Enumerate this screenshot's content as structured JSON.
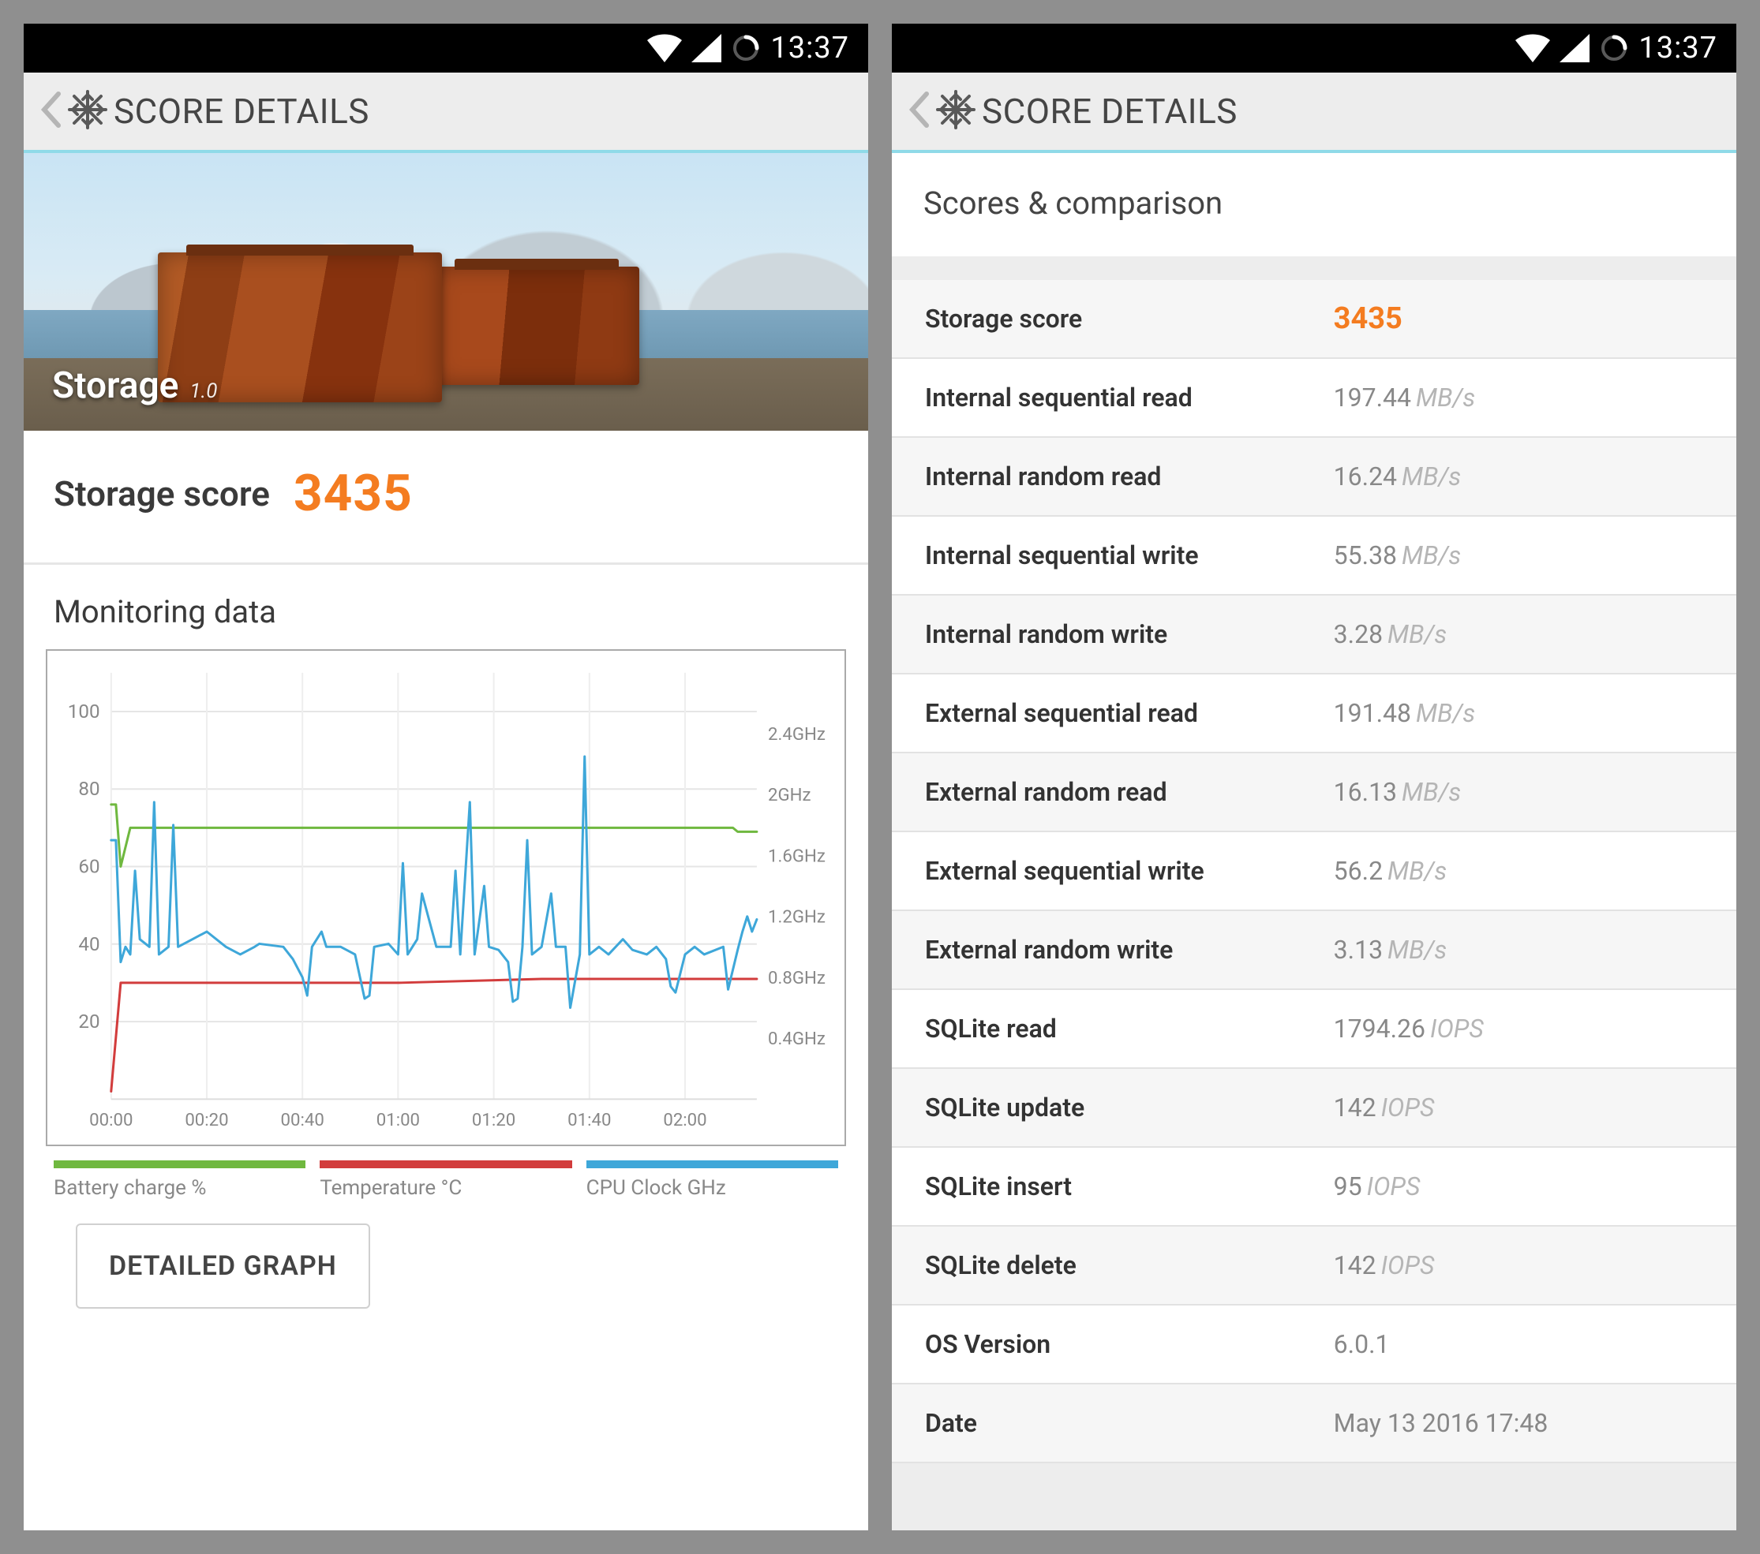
{
  "status": {
    "time": "13:37"
  },
  "header": {
    "title": "SCORE DETAILS"
  },
  "hero": {
    "title": "Storage",
    "version": "1.0"
  },
  "score": {
    "label": "Storage score",
    "value": "3435"
  },
  "monitor": {
    "title": "Monitoring data"
  },
  "chart_legend": {
    "battery": "Battery charge %",
    "temperature": "Temperature °C",
    "cpu": "CPU Clock GHz"
  },
  "detailed_button": "DETAILED GRAPH",
  "scores_section_title": "Scores & comparison",
  "rows": [
    {
      "label": "Storage score",
      "value": "3435",
      "unit": "",
      "highlight": true
    },
    {
      "label": "Internal sequential read",
      "value": "197.44",
      "unit": "MB/s"
    },
    {
      "label": "Internal random read",
      "value": "16.24",
      "unit": "MB/s"
    },
    {
      "label": "Internal sequential write",
      "value": "55.38",
      "unit": "MB/s"
    },
    {
      "label": "Internal random write",
      "value": "3.28",
      "unit": "MB/s"
    },
    {
      "label": "External sequential read",
      "value": "191.48",
      "unit": "MB/s"
    },
    {
      "label": "External random read",
      "value": "16.13",
      "unit": "MB/s"
    },
    {
      "label": "External sequential write",
      "value": "56.2",
      "unit": "MB/s"
    },
    {
      "label": "External random write",
      "value": "3.13",
      "unit": "MB/s"
    },
    {
      "label": "SQLite read",
      "value": "1794.26",
      "unit": "IOPS"
    },
    {
      "label": "SQLite update",
      "value": "142",
      "unit": "IOPS"
    },
    {
      "label": "SQLite insert",
      "value": "95",
      "unit": "IOPS"
    },
    {
      "label": "SQLite delete",
      "value": "142",
      "unit": "IOPS"
    },
    {
      "label": "OS Version",
      "value": "6.0.1",
      "unit": "",
      "plain": true
    },
    {
      "label": "Date",
      "value": "May 13 2016 17:48",
      "unit": "",
      "plain": true
    }
  ],
  "chart_data": {
    "type": "line",
    "x_ticks": [
      "00:00",
      "00:20",
      "00:40",
      "01:00",
      "01:20",
      "01:40",
      "02:00"
    ],
    "y_left_ticks": [
      20,
      40,
      60,
      80,
      100
    ],
    "y_right_ticks": [
      "0.4GHz",
      "0.8GHz",
      "1.2GHz",
      "1.6GHz",
      "2GHz",
      "2.4GHz"
    ],
    "y_left_range": [
      0,
      110
    ],
    "y_right_range": [
      0,
      2.8
    ],
    "series": [
      {
        "name": "Battery charge %",
        "color": "#6fb83f",
        "axis": "left",
        "points": [
          [
            0,
            76
          ],
          [
            1,
            76
          ],
          [
            2,
            60
          ],
          [
            4,
            70
          ],
          [
            130,
            70
          ],
          [
            131,
            69
          ],
          [
            135,
            69
          ]
        ]
      },
      {
        "name": "Temperature °C",
        "color": "#d23c3c",
        "axis": "left",
        "points": [
          [
            0,
            2
          ],
          [
            2,
            30
          ],
          [
            3,
            30
          ],
          [
            60,
            30
          ],
          [
            90,
            31
          ],
          [
            135,
            31
          ]
        ]
      },
      {
        "name": "CPU Clock GHz",
        "color": "#3ea7d9",
        "axis": "right",
        "points": [
          [
            0,
            1.7
          ],
          [
            1,
            1.7
          ],
          [
            2,
            0.9
          ],
          [
            3,
            1.0
          ],
          [
            4,
            0.95
          ],
          [
            5,
            1.5
          ],
          [
            6,
            1.05
          ],
          [
            8,
            1.0
          ],
          [
            9,
            1.95
          ],
          [
            10,
            0.95
          ],
          [
            12,
            1.0
          ],
          [
            13,
            1.8
          ],
          [
            14,
            1.0
          ],
          [
            17,
            1.05
          ],
          [
            20,
            1.1
          ],
          [
            24,
            1.0
          ],
          [
            27,
            0.95
          ],
          [
            30,
            1.0
          ],
          [
            31,
            1.02
          ],
          [
            36,
            1.0
          ],
          [
            38,
            0.92
          ],
          [
            40,
            0.8
          ],
          [
            41,
            0.68
          ],
          [
            42,
            1.0
          ],
          [
            44,
            1.1
          ],
          [
            45,
            1.0
          ],
          [
            48,
            1.0
          ],
          [
            51,
            0.95
          ],
          [
            53,
            0.66
          ],
          [
            54,
            0.68
          ],
          [
            55,
            1.0
          ],
          [
            58,
            1.02
          ],
          [
            60,
            0.95
          ],
          [
            61,
            1.55
          ],
          [
            62,
            0.95
          ],
          [
            64,
            1.05
          ],
          [
            65,
            1.35
          ],
          [
            68,
            1.0
          ],
          [
            71,
            1.0
          ],
          [
            72,
            1.5
          ],
          [
            73,
            0.95
          ],
          [
            75,
            1.95
          ],
          [
            76,
            0.95
          ],
          [
            78,
            1.4
          ],
          [
            79,
            1.0
          ],
          [
            81,
            0.98
          ],
          [
            83,
            0.9
          ],
          [
            84,
            0.64
          ],
          [
            85,
            0.66
          ],
          [
            86,
            1.0
          ],
          [
            87,
            1.7
          ],
          [
            88,
            0.95
          ],
          [
            90,
            1.0
          ],
          [
            92,
            1.35
          ],
          [
            93,
            1.0
          ],
          [
            95,
            1.0
          ],
          [
            96,
            0.6
          ],
          [
            98,
            0.95
          ],
          [
            99,
            2.25
          ],
          [
            100,
            0.95
          ],
          [
            102,
            1.0
          ],
          [
            104,
            0.95
          ],
          [
            107,
            1.05
          ],
          [
            109,
            0.98
          ],
          [
            112,
            0.95
          ],
          [
            114,
            1.0
          ],
          [
            116,
            0.92
          ],
          [
            117,
            0.74
          ],
          [
            118,
            0.7
          ],
          [
            120,
            0.95
          ],
          [
            122,
            1.0
          ],
          [
            124,
            0.95
          ],
          [
            128,
            1.0
          ],
          [
            129,
            0.72
          ],
          [
            131,
            0.98
          ],
          [
            132,
            1.1
          ],
          [
            133,
            1.2
          ],
          [
            134,
            1.1
          ],
          [
            135,
            1.18
          ]
        ]
      }
    ]
  }
}
